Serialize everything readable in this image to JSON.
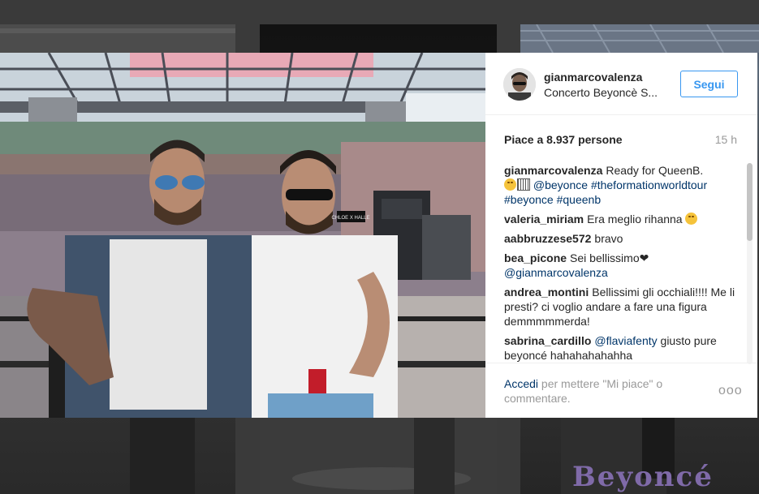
{
  "post": {
    "username": "gianmarcovalenza",
    "location": "Concerto Beyoncè S...",
    "follow_label": "Segui",
    "likes": "Piace a 8.937 persone",
    "time": "15 h"
  },
  "comments": [
    {
      "user": "gianmarcovalenza",
      "text": "Ready for QueenB.",
      "tags": [
        "@beyonce",
        "#theformationworldtour",
        "#beyonce",
        "#queenb"
      ]
    },
    {
      "user": "valeria_miriam",
      "text": "Era meglio rihanna"
    },
    {
      "user": "aabbruzzese572",
      "text": "bravo"
    },
    {
      "user": "bea_picone",
      "text": "Sei bellissimo❤",
      "tag": "@gianmarcovalenza"
    },
    {
      "user": "andrea_montini",
      "text": "Bellissimi gli occhiali!!!! Me li presti? ci voglio andare a fare una figura demmmmmerda!"
    },
    {
      "user": "sabrina_cardillo",
      "tag": "@flaviafenty",
      "text": "giusto pure beyoncé hahahahahahha"
    }
  ],
  "footer": {
    "login_link": "Accedi",
    "login_text": "per mettere \"Mi piace\" o commentare.",
    "more": "ooo"
  },
  "photo": {
    "signage_text": "CHLOE X HALLE"
  },
  "background": {
    "tile_text": "Beyoncé"
  },
  "colors": {
    "accent_blue": "#3897f0",
    "link_blue": "#003569",
    "text": "#262626",
    "muted": "#999999"
  }
}
